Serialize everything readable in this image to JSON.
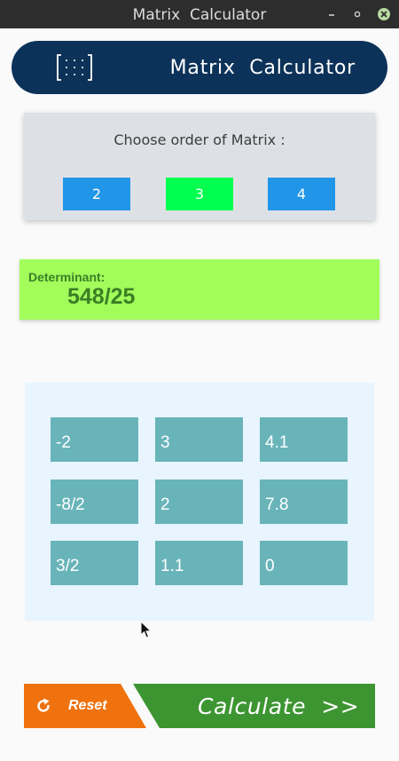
{
  "window": {
    "title": "Matrix  Calculator",
    "controls": {
      "minimize": "minimize-icon",
      "restore": "restore-icon",
      "close": "close-icon"
    }
  },
  "header": {
    "logo_icon": "matrix-bracket-icon",
    "title": "Matrix  Calculator"
  },
  "order": {
    "prompt": "Choose order of Matrix :",
    "options": [
      "2",
      "3",
      "4"
    ],
    "selected": "3",
    "colors": {
      "default": "#2196e8",
      "selected": "#00ff4f"
    }
  },
  "determinant": {
    "label": "Determinant:",
    "value": "548/25"
  },
  "matrix": {
    "rows": [
      [
        "-2",
        "3",
        "4.1"
      ],
      [
        "-8/2",
        "2",
        "7.8"
      ],
      [
        "3/2",
        "1.1",
        "0"
      ]
    ]
  },
  "actions": {
    "reset_label": "Reset",
    "reset_icon": "refresh-icon",
    "calculate_label": "Calculate  >>"
  },
  "colors": {
    "header_bg": "#0d3259",
    "determinant_bg": "#a2fd5b",
    "cell_bg": "#68b4b9",
    "reset_bg": "#f0720e",
    "calculate_bg": "#3d9532"
  }
}
